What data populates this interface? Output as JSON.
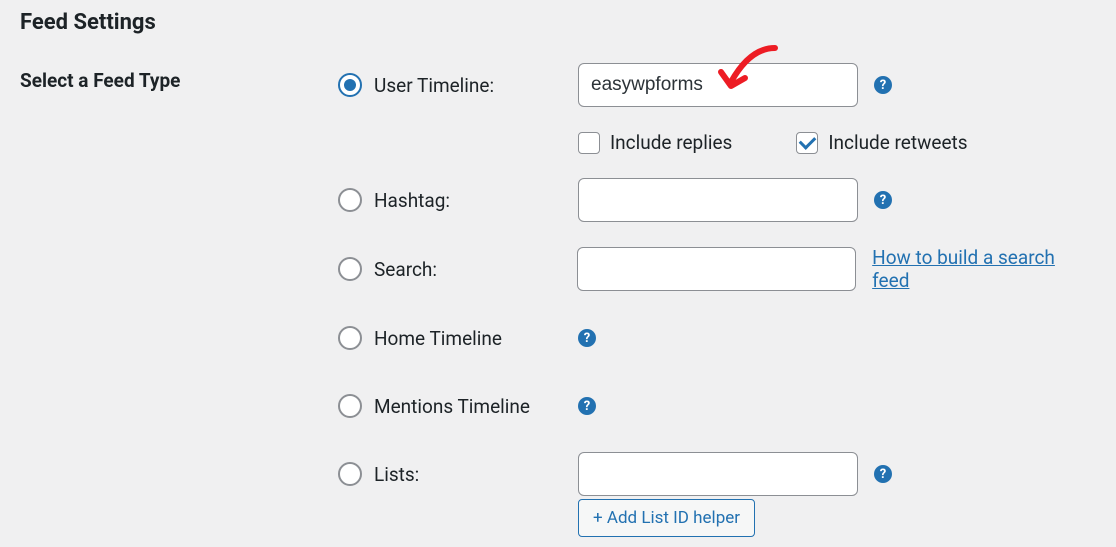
{
  "section": {
    "title": "Feed Settings",
    "field_label": "Select a Feed Type"
  },
  "feed_types": {
    "user_timeline": {
      "label": "User Timeline:",
      "value": "easywpforms"
    },
    "include_replies": {
      "label": "Include replies",
      "checked": false
    },
    "include_retweets": {
      "label": "Include retweets",
      "checked": true
    },
    "hashtag": {
      "label": "Hashtag:",
      "value": ""
    },
    "search": {
      "label": "Search:",
      "value": "",
      "help_link": "How to build a search feed"
    },
    "home_timeline": {
      "label": "Home Timeline"
    },
    "mentions_timeline": {
      "label": "Mentions Timeline"
    },
    "lists": {
      "label": "Lists:",
      "value": "",
      "button": "+ Add List ID helper"
    }
  },
  "help_glyph": "?"
}
